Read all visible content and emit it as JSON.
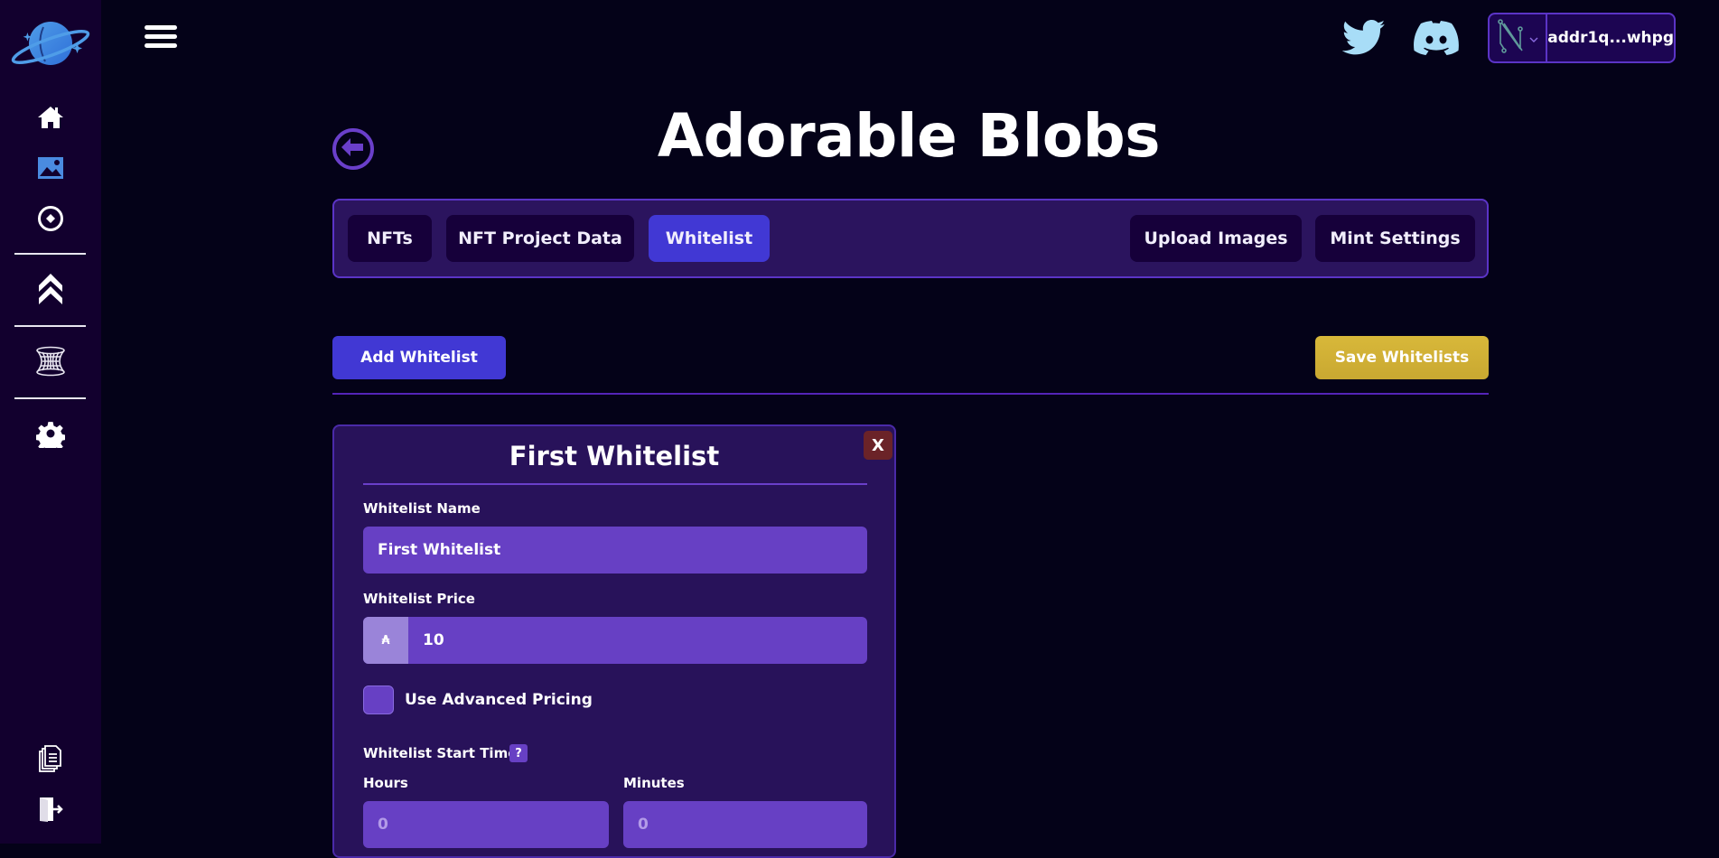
{
  "sidebar": {
    "logo": "planet-logo",
    "items": [
      {
        "icon": "home-icon",
        "label": "Home"
      },
      {
        "icon": "image-icon",
        "label": "NFTs"
      },
      {
        "icon": "target-icon",
        "label": "Mint"
      },
      {
        "icon": "double-chevron-up-icon",
        "label": "Upgrade"
      },
      {
        "icon": "wormhole-icon",
        "label": "Portal"
      },
      {
        "icon": "gear-icon",
        "label": "Settings"
      },
      {
        "icon": "documents-icon",
        "label": "Docs"
      },
      {
        "icon": "logout-icon",
        "label": "Logout"
      }
    ]
  },
  "header": {
    "social": [
      {
        "icon": "twitter-icon"
      },
      {
        "icon": "discord-icon"
      }
    ],
    "wallet": {
      "provider_icon": "nami-wallet-icon",
      "address": "addr1q...whpg"
    }
  },
  "page": {
    "title": "Adorable Blobs",
    "tabs": [
      {
        "label": "NFTs",
        "active": false
      },
      {
        "label": "NFT Project Data",
        "active": false
      },
      {
        "label": "Whitelist",
        "active": true
      },
      {
        "label": "Upload Images",
        "active": false
      },
      {
        "label": "Mint Settings",
        "active": false
      }
    ],
    "add_button": "Add Whitelist",
    "save_button": "Save Whitelists"
  },
  "whitelist_card": {
    "title": "First Whitelist",
    "close_label": "X",
    "name_label": "Whitelist Name",
    "name_value": "First Whitelist",
    "price_label": "Whitelist Price",
    "price_prefix": "₳",
    "price_value": "10",
    "advanced_pricing_label": "Use Advanced Pricing",
    "advanced_pricing_checked": false,
    "start_time_label": "Whitelist Start Time:",
    "help_label": "?",
    "hours_label": "Hours",
    "hours_placeholder": "0",
    "minutes_label": "Minutes",
    "minutes_placeholder": "0"
  },
  "colors": {
    "background": "#040218",
    "sidebar": "#12002e",
    "accent": "#4138d4",
    "panel": "#2b145e",
    "input": "#6740c4",
    "save": "#d4b336",
    "close": "#6b2328",
    "social": "#a8ddf7"
  }
}
